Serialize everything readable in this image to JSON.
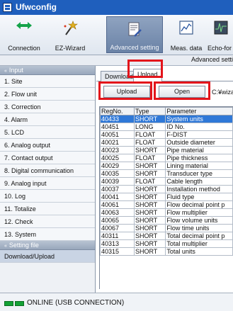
{
  "window": {
    "title": "Ufwconfig"
  },
  "toolbar": {
    "buttons": [
      {
        "label": "Connection",
        "icon": "connection-arrows-icon"
      },
      {
        "label": "EZ-Wizard",
        "icon": "wizard-icon"
      },
      {
        "label": "Advanced setting",
        "icon": "advanced-setting-icon",
        "active": true
      },
      {
        "label": "Meas. data",
        "icon": "meas-data-icon"
      },
      {
        "label": "Echo-for",
        "icon": "echo-form-icon"
      }
    ]
  },
  "subheader": {
    "text": "Advanced setti"
  },
  "sidebar": {
    "input_group": "Input",
    "items": [
      "1. Site",
      "2. Flow unit",
      "3. Correction",
      "4. Alarm",
      "5. LCD",
      "6. Analog output",
      "7. Contact output",
      "8. Digital communication",
      "9. Analog input",
      "10. Log",
      "11. Totalize",
      "12. Check",
      "13. System"
    ],
    "setting_group": "Setting file",
    "download_upload": "Download/Upload"
  },
  "main": {
    "tabs": [
      "Download",
      "Upload"
    ],
    "active_tab": "Upload",
    "upload_button": "Upload",
    "open_button": "Open",
    "path_text": "C:¥wiza"
  },
  "table": {
    "headers": [
      "RegNo.",
      "Type",
      "Parameter"
    ],
    "rows": [
      [
        "40433",
        "SHORT",
        "System units"
      ],
      [
        "40451",
        "LONG",
        "ID No."
      ],
      [
        "40051",
        "FLOAT",
        "F-DIST"
      ],
      [
        "40021",
        "FLOAT",
        "Outside diameter"
      ],
      [
        "40023",
        "SHORT",
        "Pipe material"
      ],
      [
        "40025",
        "FLOAT",
        "Pipe thickness"
      ],
      [
        "40029",
        "SHORT",
        "Lining material"
      ],
      [
        "40035",
        "SHORT",
        "Transducer type"
      ],
      [
        "40039",
        "FLOAT",
        "Cable length"
      ],
      [
        "40037",
        "SHORT",
        "Installation method"
      ],
      [
        "40041",
        "SHORT",
        "Fluid type"
      ],
      [
        "40061",
        "SHORT",
        "Flow decimal point p"
      ],
      [
        "40063",
        "SHORT",
        "Flow multiplier"
      ],
      [
        "40065",
        "SHORT",
        "Flow volume units"
      ],
      [
        "40067",
        "SHORT",
        "Flow time units"
      ],
      [
        "40311",
        "SHORT",
        "Total decimal point p"
      ],
      [
        "40313",
        "SHORT",
        "Total multiplier"
      ],
      [
        "40315",
        "SHORT",
        "Total units"
      ]
    ],
    "selected_row": 0
  },
  "status": {
    "text": "ONLINE (USB CONNECTION)"
  },
  "colors": {
    "title_bar": "#1f5fbd",
    "highlight_box": "#e3141b",
    "selected_row": "#2f78d7",
    "led": "#14a235"
  }
}
